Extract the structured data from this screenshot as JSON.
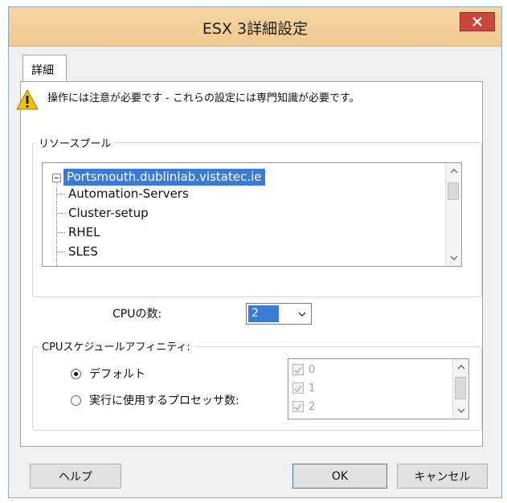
{
  "window": {
    "title": "ESX 3詳細設定"
  },
  "tab": {
    "label": "詳細"
  },
  "warning": {
    "text": "操作には注意が必要です - これらの設定には専門知識が必要です。"
  },
  "resource_pool": {
    "label": "リソースプール",
    "root": "Portsmouth.dublinlab.vistatec.ie",
    "items": [
      "Automation-Servers",
      "Cluster-setup",
      "RHEL",
      "SLES"
    ]
  },
  "cpu": {
    "label": "CPUの数:",
    "value": "2"
  },
  "affinity": {
    "label": "CPUスケジュールアフィニティ:",
    "options": [
      "デフォルト",
      "実行に使用するプロセッサ数:"
    ],
    "selected": 0,
    "cpus": [
      "0",
      "1",
      "2"
    ]
  },
  "buttons": {
    "help": "ヘルプ",
    "ok": "OK",
    "cancel": "キャンセル"
  },
  "colors": {
    "selection": "#3a7bd5",
    "titlebar": "#f0c98f",
    "close": "#c9483b"
  }
}
